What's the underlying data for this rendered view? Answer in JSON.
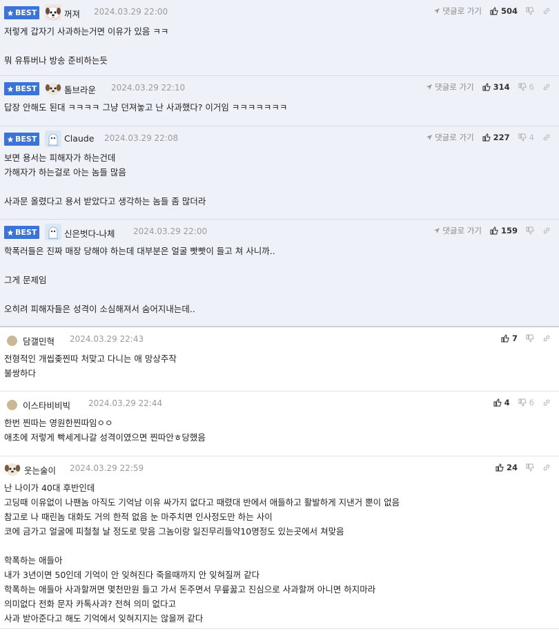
{
  "labels": {
    "best": "BEST",
    "goto": "댓글로 가기"
  },
  "comments": [
    {
      "best": true,
      "nick": "꺼져",
      "avatar": "dog-face",
      "date": "2024.03.29 22:00",
      "likes": "504",
      "dislikes": "",
      "lines": [
        "저렇게 갑자기 사과하는거면 이유가 있음 ㅋㅋ",
        "",
        "뭐 유튜버나 방송 준비하는듯"
      ]
    },
    {
      "best": true,
      "nick": "톰브라운",
      "avatar": "puppy",
      "date": "2024.03.29 22:10",
      "likes": "314",
      "dislikes": "6",
      "lines": [
        "답장 안해도 된대 ㅋㅋㅋㅋ 그냥 던져놓고 난 사과했다? 이거임 ㅋㅋㅋㅋㅋㅋㅋ"
      ]
    },
    {
      "best": true,
      "nick": "Claude",
      "avatar": "ghost",
      "date": "2024.03.29 22:08",
      "likes": "227",
      "dislikes": "4",
      "lines": [
        "보면 용서는 피해자가 하는건데",
        "가해자가 하는걸로 아는 놈들 많음",
        "",
        "사과문 올렸다고 용서 받았다고 생각하는 놈들 좀 많더라"
      ]
    },
    {
      "best": true,
      "nick": "신은벗다-나체",
      "avatar": "ghost",
      "date": "2024.03.29 22:00",
      "likes": "159",
      "dislikes": "",
      "lines": [
        "학폭러들은 진짜 매장 당해야 하는데 대부분은 얼굴 빳빳이 들고 쳐 사니까..",
        "",
        "그게 문제임",
        "",
        "오히려 피해자들은 성격이 소심해져서 숨어지내는데.."
      ]
    },
    {
      "best": false,
      "nick": "담갤민혁",
      "avatar": "dot",
      "date": "2024.03.29 22:43",
      "likes": "7",
      "dislikes": "",
      "lines": [
        "전형적인 개씹좆찐따 처맞고 다니는 애 망상주작",
        "불쌍하다"
      ]
    },
    {
      "best": false,
      "nick": "이스타비비빅",
      "avatar": "dot",
      "date": "2024.03.29 22:44",
      "likes": "4",
      "dislikes": "6",
      "lines": [
        "한번 찐따는 영원한찐따임ㅇㅇ",
        "애초에 저렇게 빡세게나갈 성격이였으면 찐따안ㅎ당했음"
      ]
    },
    {
      "best": false,
      "nick": "웃는술이",
      "avatar": "puppy",
      "date": "2024.03.29 22:59",
      "likes": "24",
      "dislikes": "",
      "lines": [
        "난 나이가 40대 후반인데",
        "고딩때 이유없이 나팬놈 아직도 기억남 이유 싸가지 없다고 때렸대 반에서 애들하고 활발하게 지낸거 뿐이 없음",
        "참고로 나 때린놈 대화도 거의 한적 없음 눈 마주치면 인사정도만 하는 사이",
        "코에 금가고 얼굴에 피철철 날 정도로 맞음 그놈이랑 일진무리들약10명정도 있는곳에서 쳐맞음",
        "",
        "학폭하는 애들아",
        "내가 3년이면 50인데 기억이 안 잊혀진다 죽을때까지 안 잊혀질꺼 같다",
        "학폭하는 애들아 사과할꺼면 몇천만원 들고 가서 돈주면서 무릎꿇고 진심으로 사과할꺼 아니면 하지마라",
        "의미없다 전화 문자 카톡사과? 전혀 의미 없다고",
        "사과 받아준다고 해도 기억에서 잊혀지지는 않을꺼 같다"
      ]
    }
  ]
}
